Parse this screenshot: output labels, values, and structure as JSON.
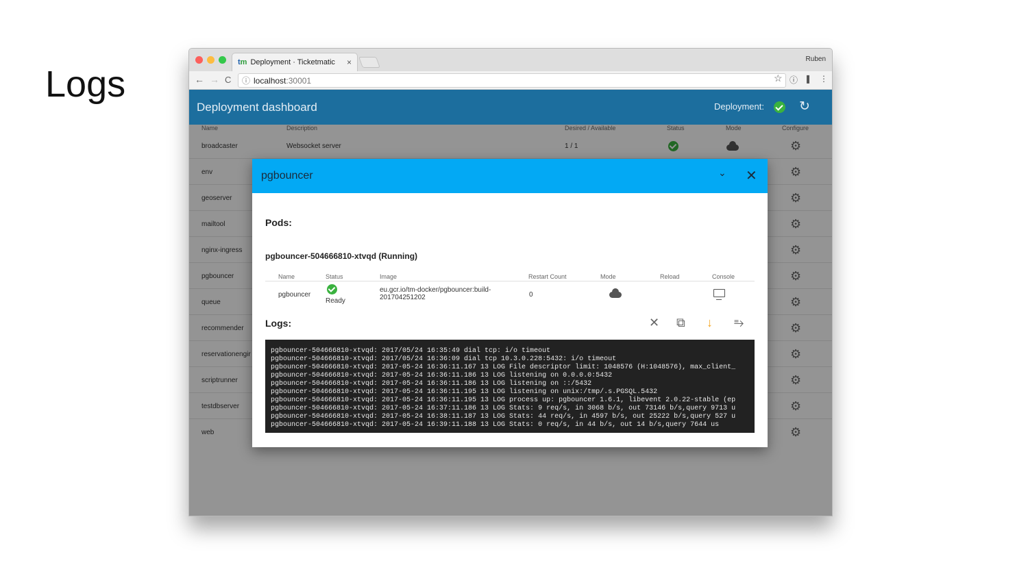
{
  "slide": {
    "title": "Logs"
  },
  "browser": {
    "tab": {
      "favicon": "tm",
      "title": "Deployment · Ticketmatic",
      "close": "×"
    },
    "user": "Ruben",
    "nav": {
      "back": "←",
      "forward": "→",
      "reload": "C"
    },
    "address": {
      "info_icon": "ⓘ",
      "host": "localhost",
      "port": ":30001"
    },
    "star": "☆",
    "extensions": [
      "ⓘ",
      "❚",
      "⋮"
    ]
  },
  "app": {
    "title": "Deployment dashboard",
    "deployment_label": "Deployment:",
    "refresh": "↻",
    "columns": [
      "Name",
      "Description",
      "Desired / Available",
      "Status",
      "Mode",
      "Configure"
    ],
    "rows": [
      {
        "name": "broadcaster",
        "description": "Websocket server",
        "avail": "1 / 1"
      },
      {
        "name": "env"
      },
      {
        "name": "geoserver"
      },
      {
        "name": "mailtool"
      },
      {
        "name": "nginx-ingress"
      },
      {
        "name": "pgbouncer"
      },
      {
        "name": "queue"
      },
      {
        "name": "recommender"
      },
      {
        "name": "reservationengir"
      },
      {
        "name": "scriptrunner"
      },
      {
        "name": "testdbserver"
      },
      {
        "name": "web"
      }
    ],
    "gear": "⚙"
  },
  "modal": {
    "title": "pgbouncer",
    "collapse": "⌄",
    "close": "✕",
    "pods_heading": "Pods:",
    "pod_name": "pgbouncer-504666810-xtvqd (Running)",
    "columns": [
      "Name",
      "Status",
      "Image",
      "Restart Count",
      "Mode",
      "Reload",
      "Console"
    ],
    "container": {
      "name": "pgbouncer",
      "status": "Ready",
      "image_line1": "eu.gcr.io/tm-docker/pgbouncer:build-",
      "image_line2": "201704251202",
      "restart_count": "0"
    },
    "logs_heading": "Logs:",
    "log_actions": [
      "✕",
      "⧉",
      "↓",
      "⥱"
    ],
    "log_lines": [
      "pgbouncer-504666810-xtvqd: 2017/05/24 16:35:49 dial tcp: i/o timeout",
      "pgbouncer-504666810-xtvqd: 2017/05/24 16:36:09 dial tcp 10.3.0.228:5432: i/o timeout",
      "pgbouncer-504666810-xtvqd: 2017-05-24 16:36:11.167 13 LOG File descriptor limit: 1048576 (H:1048576), max_client_",
      "pgbouncer-504666810-xtvqd: 2017-05-24 16:36:11.186 13 LOG listening on 0.0.0.0:5432",
      "pgbouncer-504666810-xtvqd: 2017-05-24 16:36:11.186 13 LOG listening on ::/5432",
      "pgbouncer-504666810-xtvqd: 2017-05-24 16:36:11.195 13 LOG listening on unix:/tmp/.s.PGSQL.5432",
      "pgbouncer-504666810-xtvqd: 2017-05-24 16:36:11.195 13 LOG process up: pgbouncer 1.6.1, libevent 2.0.22-stable (ep",
      "pgbouncer-504666810-xtvqd: 2017-05-24 16:37:11.186 13 LOG Stats: 9 req/s, in 3068 b/s, out 73146 b/s,query 9713 u",
      "pgbouncer-504666810-xtvqd: 2017-05-24 16:38:11.187 13 LOG Stats: 44 req/s, in 4597 b/s, out 25222 b/s,query 527 u",
      "pgbouncer-504666810-xtvqd: 2017-05-24 16:39:11.188 13 LOG Stats: 0 req/s, in 44 b/s, out 14 b/s,query 7644 us"
    ]
  },
  "colors": {
    "appbar": "#1c6e9e",
    "modal_header": "#03a9f4",
    "ok": "#3ab23f",
    "accent_download": "#f5a623"
  }
}
